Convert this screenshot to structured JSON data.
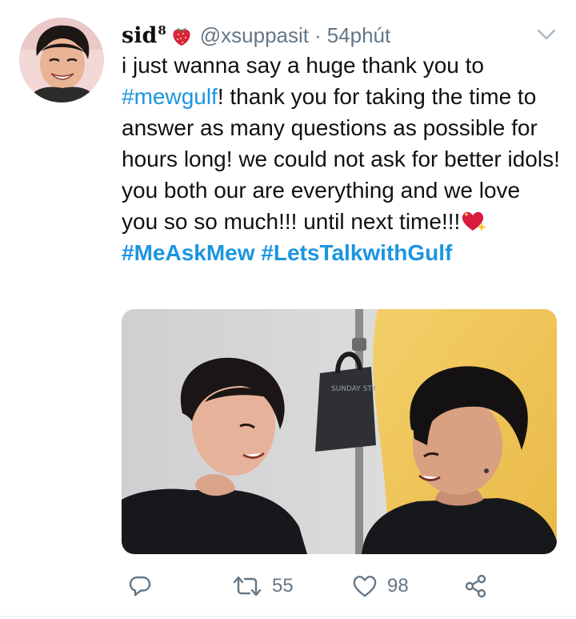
{
  "tweet": {
    "display_name": "sid",
    "superscript": "8",
    "handle": "@xsuppasit",
    "separator": "·",
    "time": "54phút",
    "text": {
      "part1": "i just wanna say a huge thank you to ",
      "mention_tag": "#mewgulf",
      "part2": "! thank you for taking the time to answer as many questions as possible for hours long! we could not ask for better idols! you both our are everything and we love you so so much!!! until next time!!!"
    },
    "hashtags": {
      "first": "#MeAskMew",
      "second": "#LetsTalkwithGulf"
    },
    "media": {
      "bag_text": "SUNDAY  STY"
    },
    "actions": {
      "retweets": "55",
      "likes": "98"
    }
  },
  "icons": {
    "avatar": "profile-photo",
    "strawberry": "strawberry-emoji",
    "heart": "sparkling-heart-emoji",
    "caret": "chevron-down-icon",
    "reply": "reply-icon",
    "retweet": "retweet-icon",
    "like": "heart-icon",
    "share": "share-icon"
  },
  "colors": {
    "link": "#1b95e0",
    "muted": "#657786",
    "text": "#111111",
    "heart_emoji": "#d81b3c"
  }
}
